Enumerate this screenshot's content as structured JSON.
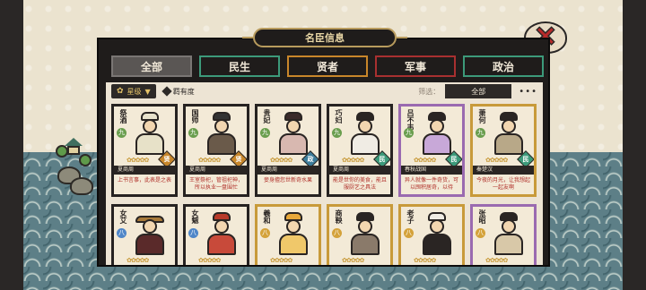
{
  "panel": {
    "title": "名臣信息"
  },
  "tabs": [
    {
      "label": "全部",
      "active": true
    },
    {
      "label": "民生",
      "active": false
    },
    {
      "label": "贤者",
      "active": false
    },
    {
      "label": "军事",
      "active": false
    },
    {
      "label": "政治",
      "active": false
    }
  ],
  "filters": {
    "sort_label": "星级",
    "fate_label": "羁有度",
    "filter_label": "筛选：",
    "filter_value": "全部",
    "more": "•••"
  },
  "stars_text": "✿✿✿✿✿",
  "cards": [
    {
      "name": "祭酒",
      "rank": "九",
      "badge": "贤",
      "era": "夏商周",
      "desc": "上书言事，此表是之表"
    },
    {
      "name": "国师",
      "rank": "九",
      "badge": "贤",
      "era": "夏商周",
      "desc": "王室祭祀，管祖祀神，所以执业一盘围忙"
    },
    {
      "name": "贵妃",
      "rank": "九",
      "badge": "政",
      "era": "夏商周",
      "desc": "妾身擅您世新奇水果"
    },
    {
      "name": "巧妇",
      "rank": "九",
      "badge": "民",
      "era": "夏商周",
      "desc": "能是世你的美食，能且服厨艺之具法"
    },
    {
      "name": "吕不韦",
      "rank": "九",
      "badge": "民",
      "era": "春秋战国",
      "desc": "异人就像一件奇货，可以囤积居奇，以待"
    },
    {
      "name": "萧何",
      "rank": "九",
      "badge": "民",
      "era": "秦楚汉",
      "desc": "今夜的月光，让我想起一起友啊"
    },
    {
      "name": "女艾",
      "rank": "八",
      "badge": "",
      "era": "",
      "desc": ""
    },
    {
      "name": "女魃",
      "rank": "八",
      "badge": "",
      "era": "",
      "desc": ""
    },
    {
      "name": "羲和",
      "rank": "八",
      "badge": "",
      "era": "",
      "desc": ""
    },
    {
      "name": "商鞅",
      "rank": "八",
      "badge": "",
      "era": "",
      "desc": ""
    },
    {
      "name": "老子",
      "rank": "八",
      "badge": "",
      "era": "",
      "desc": ""
    },
    {
      "name": "张昭",
      "rank": "八",
      "badge": "",
      "era": "",
      "desc": ""
    }
  ]
}
